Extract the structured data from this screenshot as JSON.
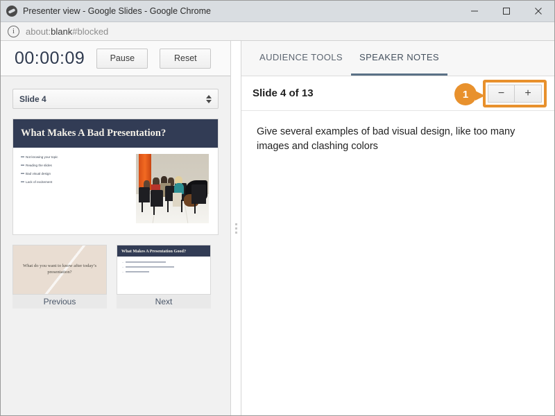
{
  "window": {
    "title": "Presenter view - Google Slides - Google Chrome",
    "app_icon": "chrome-globe-icon",
    "minimize_label": "—",
    "maximize_label": "☐",
    "close_label": "✕"
  },
  "address_bar": {
    "info_icon": "info-circle-icon",
    "url_prefix": "about:",
    "url_strong": "blank",
    "url_suffix": "#blocked"
  },
  "timer": {
    "value": "00:00:09",
    "pause_label": "Pause",
    "reset_label": "Reset"
  },
  "slide_selector": {
    "value": "Slide 4",
    "spinner_icon": "updown-spinner-icon"
  },
  "current_slide": {
    "title": "What Makes A Bad Presentation?",
    "bullets": [
      "Not knowing your topic",
      "Reading the slides",
      "Bad visual design",
      "Lack of excitement"
    ],
    "bullet_mark": "▬",
    "photo_alt": "audience-seated-in-chairs-photo",
    "header_color": "#323c55",
    "title_color": "#f4f1e8"
  },
  "thumbnails": {
    "previous": {
      "label": "Previous",
      "text": "What do you want to know after today’s presentation?",
      "background": "#e9ddd2"
    },
    "next": {
      "label": "Next",
      "title": "What Makes A Presentation Good?",
      "bullet_widths": [
        58,
        70,
        34
      ],
      "bullet_mark": "–",
      "header_color": "#323c55"
    }
  },
  "splitter": {
    "grip_icon": "drag-grip-icon"
  },
  "right_panel": {
    "tabs": [
      {
        "label": "AUDIENCE TOOLS",
        "active": false
      },
      {
        "label": "SPEAKER NOTES",
        "active": true
      }
    ],
    "active_tab_underline_color": "#5a7186",
    "notes_header": "Slide 4 of 13",
    "callout_number": "1",
    "callout_color": "#e8912d",
    "zoom_out_label": "−",
    "zoom_in_label": "+",
    "notes_text": "Give several examples of bad visual design, like too many images and clashing colors"
  }
}
